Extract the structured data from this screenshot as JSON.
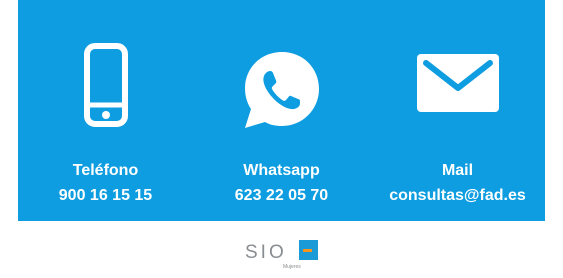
{
  "contacts": [
    {
      "icon": "phone-icon",
      "title": "Teléfono",
      "value": "900 16 15 15"
    },
    {
      "icon": "whatsapp-icon",
      "title": "Whatsapp",
      "value": "623 22 05 70"
    },
    {
      "icon": "mail-icon",
      "title": "Mail",
      "value": "consultas@fad.es"
    }
  ],
  "logo": {
    "text": "SIO",
    "subtext": "Mujeres"
  },
  "colors": {
    "panel": "#0d9de0",
    "text": "#ffffff",
    "logo_gray": "#8a8d90",
    "logo_blue": "#1a9ad6",
    "logo_orange": "#f7941d"
  }
}
